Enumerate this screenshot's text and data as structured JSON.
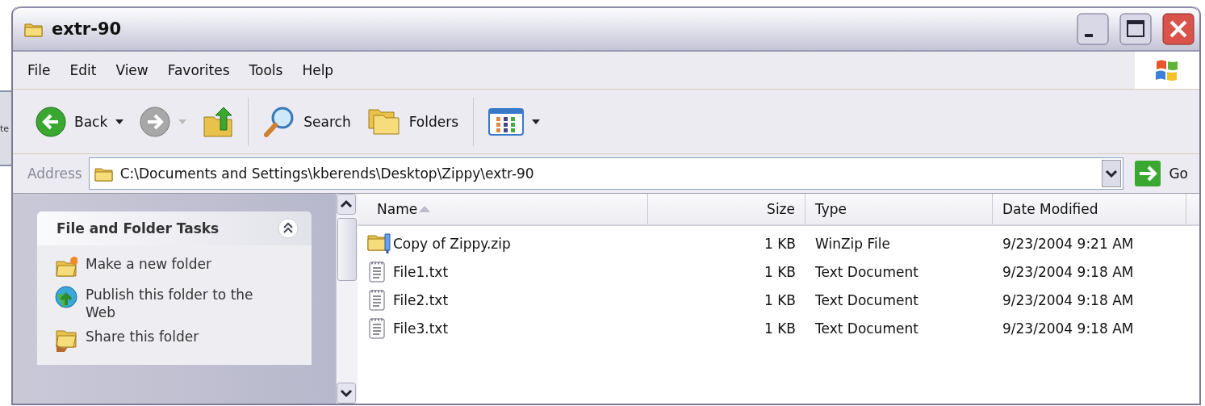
{
  "background_window": {
    "text": "te"
  },
  "window": {
    "title": "extr-90"
  },
  "menu": [
    {
      "label": "File"
    },
    {
      "label": "Edit"
    },
    {
      "label": "View"
    },
    {
      "label": "Favorites"
    },
    {
      "label": "Tools"
    },
    {
      "label": "Help"
    }
  ],
  "toolbar": {
    "back": "Back",
    "search": "Search",
    "folders": "Folders",
    "forward_disabled": true
  },
  "address_bar": {
    "label": "Address",
    "value": "C:\\Documents and Settings\\kberends\\Desktop\\Zippy\\extr-90",
    "go": "Go"
  },
  "task_pane": {
    "title": "File and Folder Tasks",
    "expanded": true,
    "items": [
      {
        "kind": "new-folder",
        "label": "Make a new folder"
      },
      {
        "kind": "publish",
        "label": "Publish this folder to the Web"
      },
      {
        "kind": "share",
        "label": "Share this folder"
      }
    ]
  },
  "file_list": {
    "columns": [
      {
        "label": "Name",
        "sorted": true
      },
      {
        "label": "Size",
        "sorted": false
      },
      {
        "label": "Type",
        "sorted": false
      },
      {
        "label": "Date Modified",
        "sorted": false
      }
    ],
    "rows": [
      {
        "kind": "zip",
        "name": "Copy of Zippy.zip",
        "size": "1 KB",
        "type": "WinZip File",
        "modified": "9/23/2004 9:21 AM"
      },
      {
        "kind": "text",
        "name": "File1.txt",
        "size": "1 KB",
        "type": "Text Document",
        "modified": "9/23/2004 9:18 AM"
      },
      {
        "kind": "text",
        "name": "File2.txt",
        "size": "1 KB",
        "type": "Text Document",
        "modified": "9/23/2004 9:18 AM"
      },
      {
        "kind": "text",
        "name": "File3.txt",
        "size": "1 KB",
        "type": "Text Document",
        "modified": "9/23/2004 9:18 AM"
      }
    ]
  }
}
